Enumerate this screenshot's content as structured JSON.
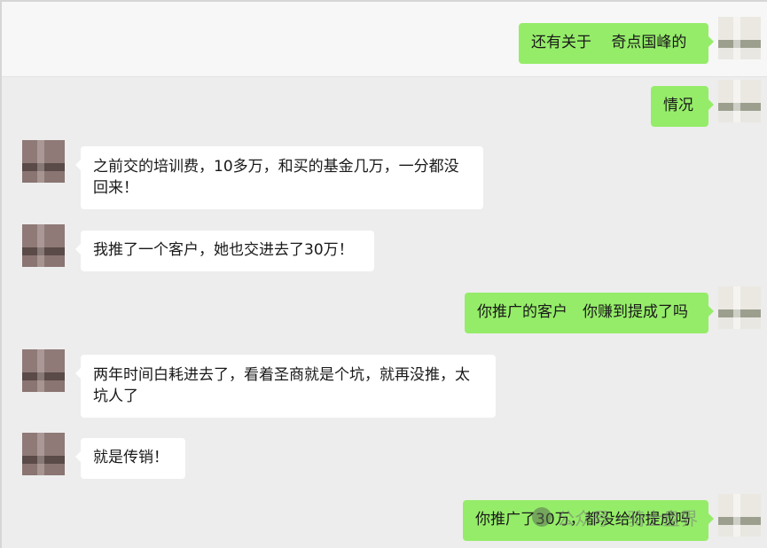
{
  "messages": [
    {
      "side": "right",
      "text": "还有关于 　奇点国峰的"
    },
    {
      "side": "right",
      "text": "情况"
    },
    {
      "side": "left",
      "text": "之前交的培训费，10多万，和买的基金几万，一分都没\n回来！"
    },
    {
      "side": "left",
      "text": "我推了一个客户，她也交进去了30万！"
    },
    {
      "side": "right",
      "text": "你推广的客户　你赚到提成了吗"
    },
    {
      "side": "left",
      "text": "两年时间白耗进去了，看着圣商就是个坑，就再没推，太\n坑人了"
    },
    {
      "side": "left",
      "text": "就是传销！"
    },
    {
      "side": "right",
      "text": "你推广了30万，都没给你提成吗"
    }
  ],
  "watermark": "公众号 · 骑士盘界",
  "colors": {
    "background": "#ededed",
    "bubble_right": "#95ec69",
    "bubble_left": "#ffffff"
  }
}
